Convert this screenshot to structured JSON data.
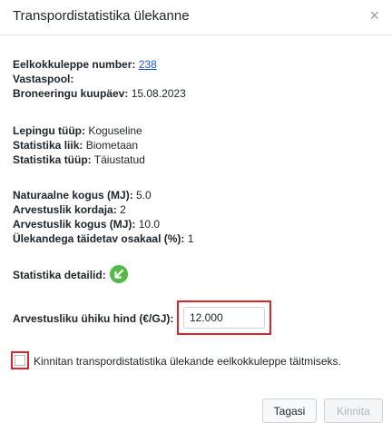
{
  "modal": {
    "title": "Transpordistatistika ülekanne",
    "close_glyph": "×"
  },
  "agreement": {
    "number_label": "Eelkokkuleppe number:",
    "number_value": "238",
    "counterparty_label": "Vastaspool:",
    "counterparty_value": "",
    "booking_date_label": "Broneeringu kuupäev:",
    "booking_date_value": "15.08.2023"
  },
  "contract": {
    "type_label": "Lepingu tüüp:",
    "type_value": "Koguseline",
    "stat_kind_label": "Statistika liik:",
    "stat_kind_value": "Biometaan",
    "stat_type_label": "Statistika tüüp:",
    "stat_type_value": "Täiustatud"
  },
  "quantities": {
    "natural_label": "Naturaalne kogus (MJ):",
    "natural_value": "5.0",
    "factor_label": "Arvestuslik kordaja:",
    "factor_value": "2",
    "calc_label": "Arvestuslik kogus (MJ):",
    "calc_value": "10.0",
    "share_label": "Ülekandega täidetav osakaal (%):",
    "share_value": "1"
  },
  "details": {
    "label": "Statistika detailid:",
    "icon": "arrow-diagonal-icon",
    "icon_color": "#55b949"
  },
  "price": {
    "label": "Arvestusliku ühiku hind (€/GJ):",
    "value": "12.000"
  },
  "confirm": {
    "text": "Kinnitan transpordistatistika ülekande eelkokkuleppe täitmiseks.",
    "checked": false
  },
  "buttons": {
    "back": "Tagasi",
    "confirm": "Kinnita"
  },
  "colors": {
    "highlight": "#d9262b",
    "link": "#1a56db"
  }
}
